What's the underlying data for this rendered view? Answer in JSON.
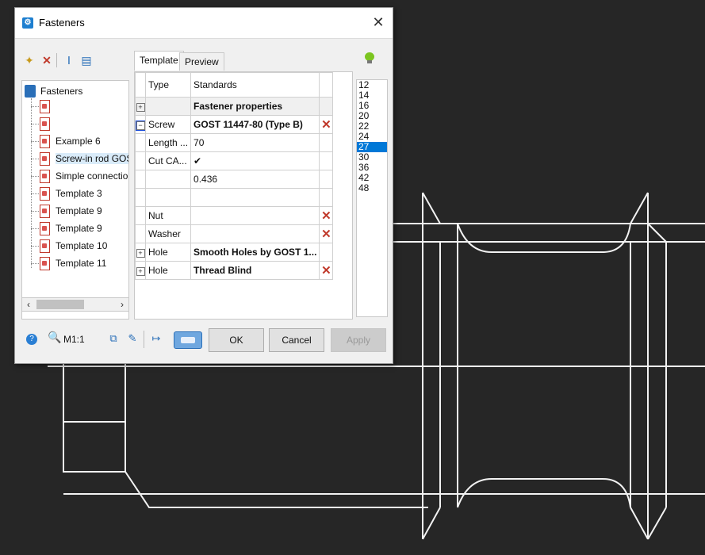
{
  "dialog": {
    "title": "Fasteners",
    "close_glyph": "✕"
  },
  "left_toolbar": [
    "new-icon",
    "delete-icon",
    "rename-icon",
    "properties-icon"
  ],
  "tree": {
    "root": "Fasteners",
    "items": [
      {
        "label": ""
      },
      {
        "label": ""
      },
      {
        "label": "Example 6"
      },
      {
        "label": "Screw-in rod GOST"
      },
      {
        "label": "Simple connection"
      },
      {
        "label": "Template 3"
      },
      {
        "label": "Template 9"
      },
      {
        "label": "Template 9"
      },
      {
        "label": "Template 10"
      },
      {
        "label": "Template 11"
      }
    ],
    "selected_index": 3
  },
  "tabs": {
    "template": "Template",
    "preview": "Preview"
  },
  "grid": {
    "header": {
      "type": "Type",
      "standards": "Standards"
    },
    "rows": [
      {
        "expander": "+",
        "type": "",
        "standard": "Fastener properties",
        "bold": true,
        "delete": false
      },
      {
        "expander": "−",
        "type": "Screw",
        "standard": "GOST 11447-80 (Type B)",
        "bold": true,
        "delete": true
      },
      {
        "expander": "",
        "type": "Length ...",
        "standard": "70",
        "bold": false,
        "delete": false
      },
      {
        "expander": "",
        "type": "Cut CA...",
        "standard": "✔",
        "bold": false,
        "delete": false
      },
      {
        "expander": "",
        "type": "",
        "standard": "0.436",
        "bold": false,
        "delete": false
      },
      {
        "expander": "",
        "type": "",
        "standard": "",
        "bold": false,
        "delete": false
      },
      {
        "expander": "",
        "type": "Nut",
        "standard": "",
        "bold": false,
        "delete": true
      },
      {
        "expander": "",
        "type": "Washer",
        "standard": "",
        "bold": false,
        "delete": true
      },
      {
        "expander": "+",
        "type": "Hole",
        "standard": "Smooth Holes by GOST 1...",
        "bold": true,
        "delete": false
      },
      {
        "expander": "+",
        "type": "Hole",
        "standard": "Thread Blind",
        "bold": true,
        "delete": true
      }
    ]
  },
  "sizes": {
    "values": [
      "12",
      "14",
      "16",
      "20",
      "22",
      "24",
      "27",
      "30",
      "36",
      "42",
      "48"
    ],
    "selected": "27"
  },
  "bottom": {
    "scale": "M1:1",
    "ok": "OK",
    "cancel": "Cancel",
    "apply": "Apply"
  },
  "colors": {
    "background": "#262626",
    "drawing": "#ffffff",
    "selection": "#0078d7",
    "delete": "#c0392b"
  }
}
